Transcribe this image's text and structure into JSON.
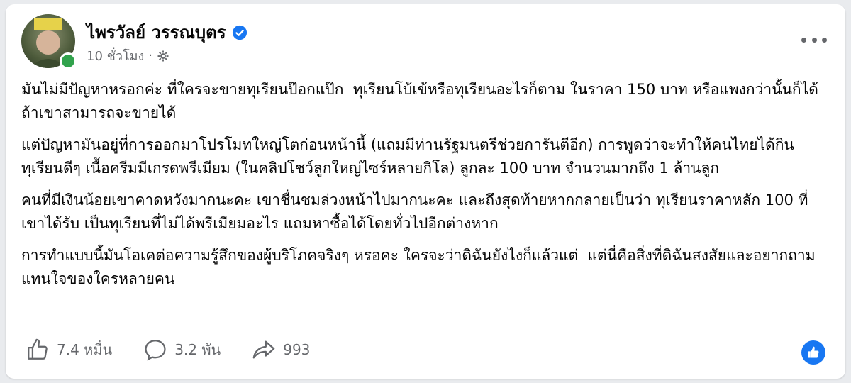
{
  "post": {
    "author": "ไพรวัลย์ วรรณบุตร",
    "time": "10 ชั่วโมง",
    "separator": "·",
    "paragraphs": [
      "มันไม่มีปัญหาหรอกค่ะ ที่ใครจะขายทุเรียนป๊อกแป๊ก  ทุเรียนโบ้เข้หรือทุเรียนอะไรก็ตาม ในราคา 150 บาท หรือแพงกว่านั้นก็ได้ ถ้าเขาสามารถจะขายได้",
      "แต่ปัญหามันอยู่ที่การออกมาโปรโมทใหญ่โตก่อนหน้านี้ (แถมมีท่านรัฐมนตรีช่วยการันตีอีก) การพูดว่าจะทำให้คนไทยได้กินทุเรียนดีๆ เนื้อครีมมีเกรดพรีเมียม (ในคลิปโชว์ลูกใหญ่ไซร์หลายกิโล) ลูกละ 100 บาท จำนวนมากถึง 1 ล้านลูก",
      "คนที่มีเงินน้อยเขาคาดหวังมากนะคะ เขาชื่นชมล่วงหน้าไปมากนะคะ และถึงสุดท้ายหากกลายเป็นว่า ทุเรียนราคาหลัก 100 ที่เขาได้รับ เป็นทุเรียนที่ไม่ได้พรีเมียมอะไร แถมหาซื้อได้โดยทั่วไปอีกต่างหาก",
      "การทำแบบนี้มันโอเคต่อความรู้สึกของผู้บริโภคจริงๆ หรอคะ ใครจะว่าดิฉันยังไงก็แล้วแต่  แต่นี่คือสิ่งที่ดิฉันสงสัยและอยากถามแทนใจของใครหลายคน"
    ]
  },
  "actions": {
    "likes": "7.4 หมื่น",
    "comments": "3.2 พัน",
    "shares": "993"
  },
  "colors": {
    "verified": "#1877f2",
    "online": "#31a24c",
    "muted": "#65676b"
  }
}
